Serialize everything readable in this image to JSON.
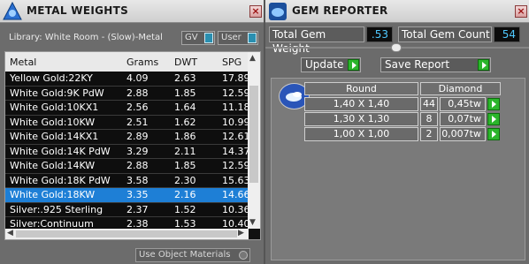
{
  "metal_panel": {
    "title": "METAL WEIGHTS",
    "library_label": "Library: White Room - (Slow)-Metal",
    "toggle_gv": "GV",
    "toggle_user": "User",
    "columns": [
      "Metal",
      "Grams",
      "DWT",
      "SPG"
    ],
    "rows": [
      [
        "Yellow Gold:22KY",
        "4.09",
        "2.63",
        "17.89"
      ],
      [
        "White Gold:9K PdW",
        "2.88",
        "1.85",
        "12.59"
      ],
      [
        "White Gold:10KX1",
        "2.56",
        "1.64",
        "11.18"
      ],
      [
        "White Gold:10KW",
        "2.51",
        "1.62",
        "10.99"
      ],
      [
        "White Gold:14KX1",
        "2.89",
        "1.86",
        "12.61"
      ],
      [
        "White Gold:14K PdW",
        "3.29",
        "2.11",
        "14.37"
      ],
      [
        "White Gold:14KW",
        "2.88",
        "1.85",
        "12.59"
      ],
      [
        "White Gold:18K PdW",
        "3.58",
        "2.30",
        "15.63"
      ],
      [
        "White Gold:18KW",
        "3.35",
        "2.16",
        "14.66"
      ],
      [
        "Silver:.925 Sterling",
        "2.37",
        "1.52",
        "10.36"
      ],
      [
        "Silver:Continuum",
        "2.38",
        "1.53",
        "10.40"
      ]
    ],
    "selected_index": 8,
    "use_object_materials": "Use Object Materials"
  },
  "gem_panel": {
    "title": "GEM REPORTER",
    "total_weight_label": "Total Gem Weight",
    "total_weight_value": ".53",
    "total_count_label": "Total Gem Count",
    "total_count_value": "54",
    "update_label": "Update",
    "save_report_label": "Save Report",
    "header_shape": "Round",
    "header_type": "Diamond",
    "gems": [
      {
        "size": "1,40 X 1,40",
        "count": "44",
        "weight": "0,45tw"
      },
      {
        "size": "1,30 X 1,30",
        "count": "8",
        "weight": "0,07tw"
      },
      {
        "size": "1,00 X 1,00",
        "count": "2",
        "weight": "0,007tw"
      }
    ]
  },
  "colors": {
    "selection": "#1e7fd6",
    "value_text": "#4fc9ff",
    "go_button": "#2bb52b"
  }
}
